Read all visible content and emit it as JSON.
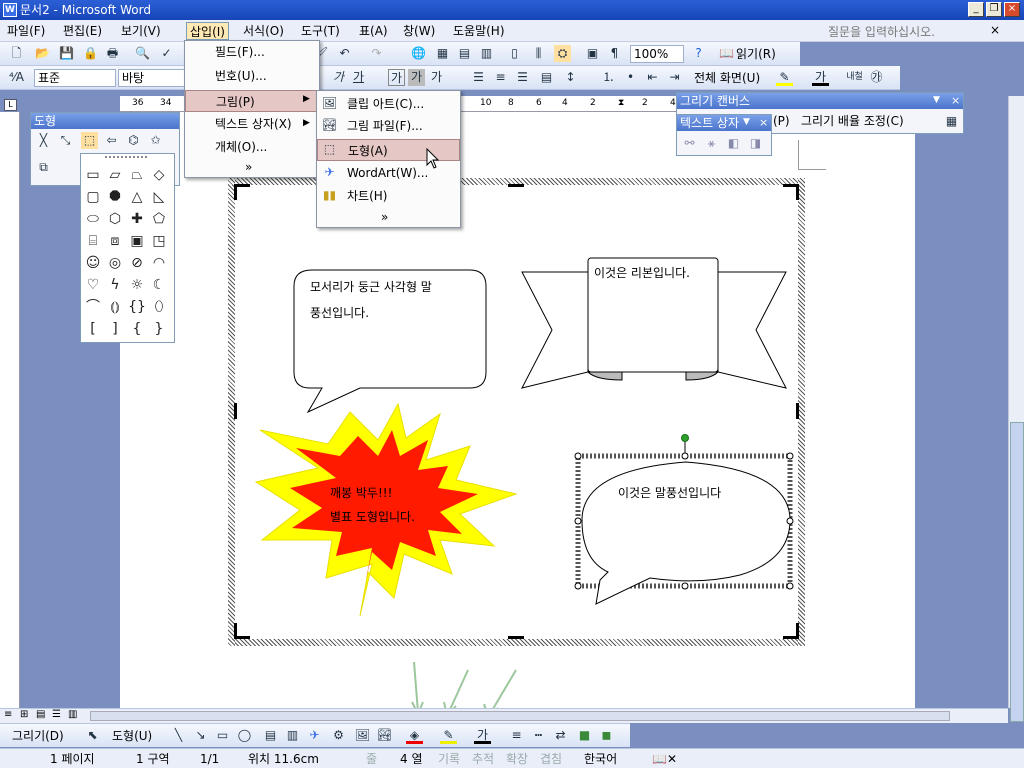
{
  "window": {
    "title": "문서2 - Microsoft Word",
    "icon": "W"
  },
  "menubar": {
    "items": [
      "파일(F)",
      "편집(E)",
      "보기(V)",
      "삽입(I)",
      "서식(O)",
      "도구(T)",
      "표(A)",
      "창(W)",
      "도움말(H)"
    ],
    "help_placeholder": "질문을 입력하십시오."
  },
  "toolbar1": {
    "zoom": "100%",
    "read_label": "읽기(R)"
  },
  "toolbar2": {
    "style": "표준",
    "font": "바탕",
    "fullscreen_label": "전체 화면(U)",
    "glyph_gal": "가",
    "glyph_ga2": "가",
    "glyph_naecheol": "내철"
  },
  "ruler": {
    "labels": [
      "36",
      "34",
      "10",
      "8",
      "6",
      "4",
      "2",
      "2",
      "4"
    ]
  },
  "insert_menu": {
    "items": [
      "필드(F)...",
      "번호(U)...",
      "그림(P)",
      "텍스트 상자(X)",
      "개체(O)..."
    ],
    "more": "»"
  },
  "picture_submenu": {
    "items": [
      "클립 아트(C)...",
      "그림 파일(F)...",
      "도형(A)",
      "WordArt(W)...",
      "차트(H)"
    ],
    "more": "»"
  },
  "shapes_panel": {
    "title": "도형"
  },
  "canvas_toolbar": {
    "title": "그리기 캔버스",
    "fit_label": "(P)",
    "scale_label": "그리기 배율 조정(C)"
  },
  "textbox_toolbar": {
    "title": "텍스트 상자"
  },
  "shapes": {
    "rounded_callout": [
      "모서리가 둥근 사각형 말",
      "풍선입니다."
    ],
    "ribbon": "이것은 리본입니다.",
    "explosion": [
      "깨봉 박두!!!",
      "별표 도형입니다."
    ],
    "oval_callout": "이것은 말풍선입니다"
  },
  "drawing_toolbar": {
    "draw_label": "그리기(D)",
    "autoshape_label": "도형(U)",
    "font_color_glyph": "가"
  },
  "statusbar": {
    "page": "1 페이지",
    "section": "1 구역",
    "pages": "1/1",
    "position": "위치 11.6cm",
    "line": "줄",
    "column": "4 열",
    "rec": "기록",
    "trk": "추적",
    "ext": "확장",
    "ovr": "겹침",
    "lang": "한국어"
  },
  "colors": {
    "explosion_outer": "#ffff00",
    "explosion_inner": "#ff1a00",
    "title_blue": "#1845b8",
    "selection_green": "#2ca02c"
  }
}
